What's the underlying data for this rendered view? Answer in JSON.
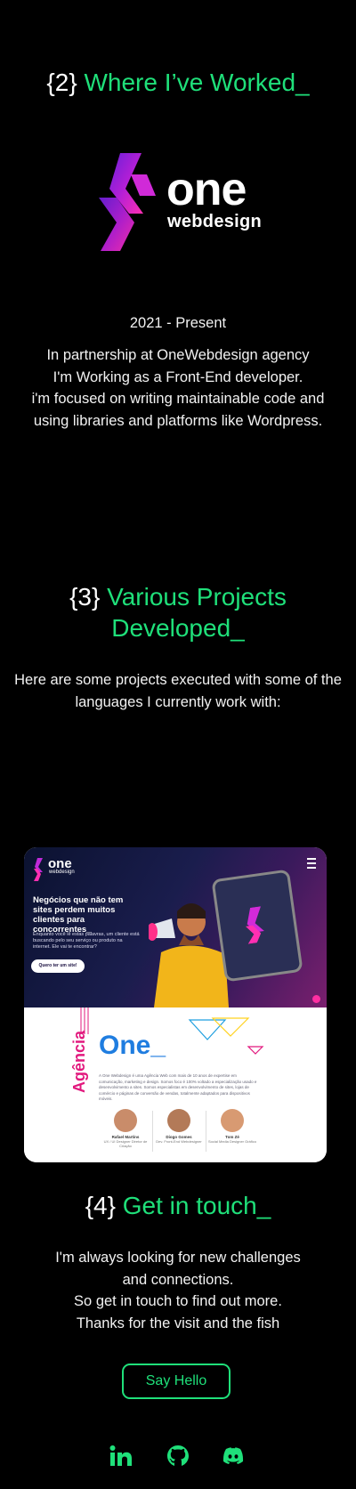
{
  "work": {
    "num": "{2}",
    "title": "Where I’ve Worked_",
    "logo_word": "one",
    "logo_sub": "webdesign",
    "period": "2021 - Present",
    "lines": [
      "In partnership at OneWebdesign agency",
      "I'm Working as a Front-End developer.",
      "i'm focused on writing maintainable code and",
      "using libraries and platforms like Wordpress."
    ]
  },
  "projects": {
    "num": "{3}",
    "title_line1": "Various Projects",
    "title_line2": "Developed_",
    "lines": [
      "Here are some projects executed with some of the",
      "languages I currently work with:"
    ],
    "preview": {
      "logo_word": "one",
      "logo_sub": "webdesign",
      "hero_title": "Negócios que não tem sites perdem muitos clientes para concorrentes_",
      "hero_text": "Enquanto você lê estas palavras, um cliente está buscando pelo seu serviço ou produto na internet. Ele vai te encontrar?",
      "hero_button": "Quero ter um site!",
      "vertical_word": "Agência",
      "big_word": "One_",
      "description": "A One Webdesign é uma Agência Web com mais de 10 anos de expertise em comunicação, marketing e design. Somos foco é 100% voltado a especialização usado e desenvolvimento a sites. Somos especialistas em desenvolvimento de sites, lojas de comércio e páginas de conversão de vendas, totalmente adaptados para dispositivos móveis.",
      "team": [
        {
          "name": "Rafael Martins",
          "role": "UX / UI Designer\nDiretor de Criação"
        },
        {
          "name": "Diogo Gomes",
          "role": "Dev. Front-End\nWebdesigner"
        },
        {
          "name": "Tom Zé",
          "role": "Social Media\nDesigner Gráfico"
        }
      ]
    }
  },
  "contact": {
    "num": "{4}",
    "title": "Get in touch_",
    "lines": [
      "I'm always looking for new challenges",
      "and connections.",
      "So get in touch to find out more.",
      "Thanks for the visit and the fish"
    ],
    "button": "Say Hello",
    "social": [
      {
        "icon": "linkedin-icon"
      },
      {
        "icon": "github-icon"
      },
      {
        "icon": "discord-icon"
      }
    ]
  },
  "colors": {
    "accent": "#1fe07a",
    "background": "#000000",
    "brand_magenta": "#b31fd6"
  }
}
